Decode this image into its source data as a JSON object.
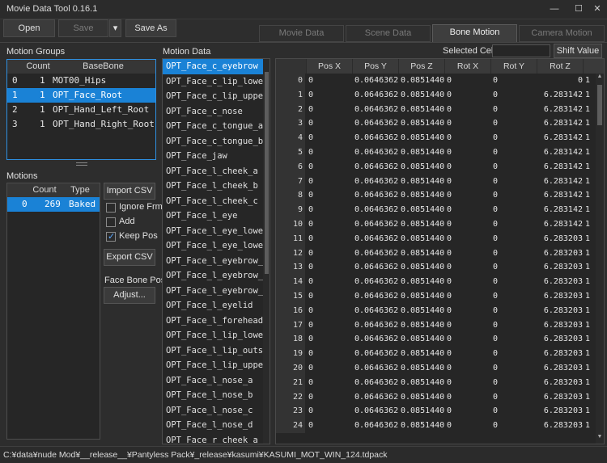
{
  "window": {
    "title": "Movie Data Tool 0.16.1",
    "minimize": "—",
    "maximize": "☐",
    "close": "✕"
  },
  "toolbar": {
    "open": "Open",
    "save": "Save",
    "save_dropdown": "▾",
    "save_as": "Save As"
  },
  "tabs": [
    "Movie Data",
    "Scene Data",
    "Bone Motion",
    "Camera Motion"
  ],
  "active_tab": 2,
  "motion_groups": {
    "label": "Motion Groups",
    "columns": [
      "Count",
      "BaseBone"
    ],
    "rows": [
      {
        "idx": "0",
        "count": "1",
        "bone": "MOT00_Hips"
      },
      {
        "idx": "1",
        "count": "1",
        "bone": "OPT_Face_Root"
      },
      {
        "idx": "2",
        "count": "1",
        "bone": "OPT_Hand_Left_Root"
      },
      {
        "idx": "3",
        "count": "1",
        "bone": "OPT_Hand_Right_Root"
      }
    ],
    "selected": 1
  },
  "motions": {
    "label": "Motions",
    "columns": [
      "Count",
      "Type"
    ],
    "rows": [
      {
        "idx": "0",
        "count": "269",
        "type": "Baked"
      }
    ]
  },
  "side": {
    "import_csv": "Import CSV",
    "ignore_frm": "Ignore Frm",
    "add": "Add",
    "keep_pos": "Keep Pos",
    "export_csv": "Export CSV",
    "face_bone_pos": "Face Bone Pos.",
    "adjust": "Adjust..."
  },
  "motion_data": {
    "label": "Motion Data",
    "items": [
      "OPT_Face_c_eyebrow",
      "OPT_Face_c_lip_lower",
      "OPT_Face_c_lip_upper",
      "OPT_Face_c_nose",
      "OPT_Face_c_tongue_a",
      "OPT_Face_c_tongue_b",
      "OPT_Face_jaw",
      "OPT_Face_l_cheek_a",
      "OPT_Face_l_cheek_b",
      "OPT_Face_l_cheek_c",
      "OPT_Face_l_eye",
      "OPT_Face_l_eye_lower_a",
      "OPT_Face_l_eye_lower_b",
      "OPT_Face_l_eyebrow_a",
      "OPT_Face_l_eyebrow_b",
      "OPT_Face_l_eyebrow_c",
      "OPT_Face_l_eyelid",
      "OPT_Face_l_forehead",
      "OPT_Face_l_lip_lower",
      "OPT_Face_l_lip_outside",
      "OPT_Face_l_lip_upper",
      "OPT_Face_l_nose_a",
      "OPT_Face_l_nose_b",
      "OPT_Face_l_nose_c",
      "OPT_Face_l_nose_d",
      "OPT_Face_r_cheek_a"
    ],
    "selected": 0
  },
  "selected_cells": {
    "label": "Selected Cells",
    "value": "",
    "shift_value": "Shift Value"
  },
  "grid": {
    "columns": [
      "Pos X",
      "Pos Y",
      "Pos Z",
      "Rot X",
      "Rot Y",
      "Rot Z"
    ],
    "rows": [
      [
        "0",
        "0",
        "0.0646362",
        "0.0851440",
        "0",
        "0",
        "0",
        "1"
      ],
      [
        "1",
        "0",
        "0.0646362",
        "0.0851440",
        "0",
        "0",
        "6.283142",
        "1"
      ],
      [
        "2",
        "0",
        "0.0646362",
        "0.0851440",
        "0",
        "0",
        "6.283142",
        "1"
      ],
      [
        "3",
        "0",
        "0.0646362",
        "0.0851440",
        "0",
        "0",
        "6.283142",
        "1"
      ],
      [
        "4",
        "0",
        "0.0646362",
        "0.0851440",
        "0",
        "0",
        "6.283142",
        "1"
      ],
      [
        "5",
        "0",
        "0.0646362",
        "0.0851440",
        "0",
        "0",
        "6.283142",
        "1"
      ],
      [
        "6",
        "0",
        "0.0646362",
        "0.0851440",
        "0",
        "0",
        "6.283142",
        "1"
      ],
      [
        "7",
        "0",
        "0.0646362",
        "0.0851440",
        "0",
        "0",
        "6.283142",
        "1"
      ],
      [
        "8",
        "0",
        "0.0646362",
        "0.0851440",
        "0",
        "0",
        "6.283142",
        "1"
      ],
      [
        "9",
        "0",
        "0.0646362",
        "0.0851440",
        "0",
        "0",
        "6.283142",
        "1"
      ],
      [
        "10",
        "0",
        "0.0646362",
        "0.0851440",
        "0",
        "0",
        "6.283142",
        "1"
      ],
      [
        "11",
        "0",
        "0.0646362",
        "0.0851440",
        "0",
        "0",
        "6.283203",
        "1"
      ],
      [
        "12",
        "0",
        "0.0646362",
        "0.0851440",
        "0",
        "0",
        "6.283203",
        "1"
      ],
      [
        "13",
        "0",
        "0.0646362",
        "0.0851440",
        "0",
        "0",
        "6.283203",
        "1"
      ],
      [
        "14",
        "0",
        "0.0646362",
        "0.0851440",
        "0",
        "0",
        "6.283203",
        "1"
      ],
      [
        "15",
        "0",
        "0.0646362",
        "0.0851440",
        "0",
        "0",
        "6.283203",
        "1"
      ],
      [
        "16",
        "0",
        "0.0646362",
        "0.0851440",
        "0",
        "0",
        "6.283203",
        "1"
      ],
      [
        "17",
        "0",
        "0.0646362",
        "0.0851440",
        "0",
        "0",
        "6.283203",
        "1"
      ],
      [
        "18",
        "0",
        "0.0646362",
        "0.0851440",
        "0",
        "0",
        "6.283203",
        "1"
      ],
      [
        "19",
        "0",
        "0.0646362",
        "0.0851440",
        "0",
        "0",
        "6.283203",
        "1"
      ],
      [
        "20",
        "0",
        "0.0646362",
        "0.0851440",
        "0",
        "0",
        "6.283203",
        "1"
      ],
      [
        "21",
        "0",
        "0.0646362",
        "0.0851440",
        "0",
        "0",
        "6.283203",
        "1"
      ],
      [
        "22",
        "0",
        "0.0646362",
        "0.0851440",
        "0",
        "0",
        "6.283203",
        "1"
      ],
      [
        "23",
        "0",
        "0.0646362",
        "0.0851440",
        "0",
        "0",
        "6.283203",
        "1"
      ],
      [
        "24",
        "0",
        "0.0646362",
        "0.0851440",
        "0",
        "0",
        "6.283203",
        "1"
      ]
    ]
  },
  "status": {
    "path": "C:¥data¥nude Mod¥__release__¥Pantyless Pack¥_release¥kasumi¥KASUMI_MOT_WIN_124.tdpack"
  },
  "colors": {
    "selection": "#1a82d6",
    "focus_border": "#2f8fe0",
    "check": "#58a6ff"
  }
}
